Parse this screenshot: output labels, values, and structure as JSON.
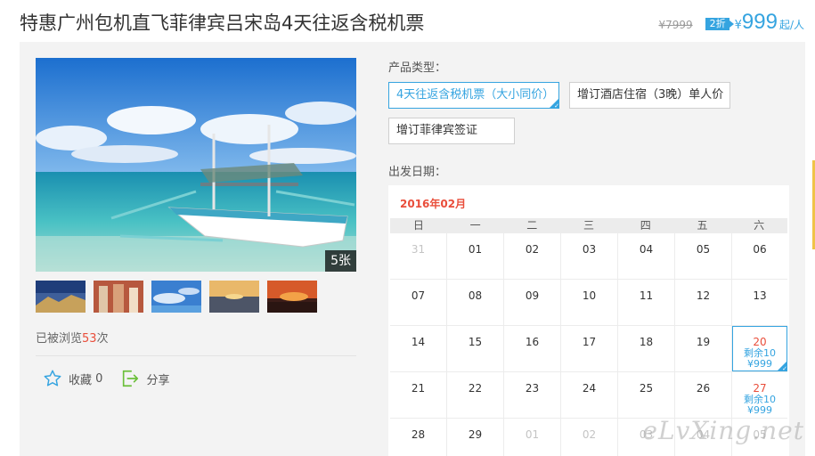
{
  "header": {
    "title": "特惠广州包机直飞菲律宾吕宋岛4天往返含税机票",
    "old_price": "¥7999",
    "discount": "2折",
    "yen": "¥",
    "price": "999",
    "unit": "起/人"
  },
  "gallery": {
    "photo_count": "5张",
    "thumbnails": [
      "mountain-dusk",
      "building-red",
      "sky-blue",
      "sunset-sea",
      "sunset-fire"
    ]
  },
  "stats": {
    "views_prefix": "已被浏览",
    "views_count": "53",
    "views_suffix": "次"
  },
  "actions": {
    "favorite_label": "收藏",
    "favorite_count": "0",
    "share_label": "分享"
  },
  "product_type": {
    "label": "产品类型：",
    "options": [
      "4天往返含税机票（大小同价）",
      "增订酒店住宿（3晚）单人价",
      "增订菲律宾签证"
    ],
    "selected_index": 0
  },
  "departure": {
    "label": "出发日期："
  },
  "calendar": {
    "month": "2016年02月",
    "weekdays": [
      "日",
      "一",
      "二",
      "三",
      "四",
      "五",
      "六"
    ],
    "weeks": [
      [
        {
          "d": "31",
          "muted": true
        },
        {
          "d": "01"
        },
        {
          "d": "02"
        },
        {
          "d": "03"
        },
        {
          "d": "04"
        },
        {
          "d": "05"
        },
        {
          "d": "06"
        }
      ],
      [
        {
          "d": "07"
        },
        {
          "d": "08"
        },
        {
          "d": "09"
        },
        {
          "d": "10"
        },
        {
          "d": "11"
        },
        {
          "d": "12"
        },
        {
          "d": "13"
        }
      ],
      [
        {
          "d": "14"
        },
        {
          "d": "15"
        },
        {
          "d": "16"
        },
        {
          "d": "17"
        },
        {
          "d": "18"
        },
        {
          "d": "19"
        },
        {
          "d": "20",
          "remain": "剩余10",
          "price": "¥999",
          "active": true
        }
      ],
      [
        {
          "d": "21"
        },
        {
          "d": "22"
        },
        {
          "d": "23"
        },
        {
          "d": "24"
        },
        {
          "d": "25"
        },
        {
          "d": "26"
        },
        {
          "d": "27",
          "remain": "剩余10",
          "price": "¥999"
        }
      ],
      [
        {
          "d": "28"
        },
        {
          "d": "29"
        },
        {
          "d": "01",
          "muted": true
        },
        {
          "d": "02",
          "muted": true
        },
        {
          "d": "03",
          "muted": true
        },
        {
          "d": "04",
          "muted": true
        },
        {
          "d": "05",
          "muted": true
        }
      ]
    ]
  },
  "watermark": "eLvXing.net",
  "colors": {
    "accent": "#35a4e0",
    "red": "#e94e3b",
    "panel": "#f3f3f3"
  }
}
